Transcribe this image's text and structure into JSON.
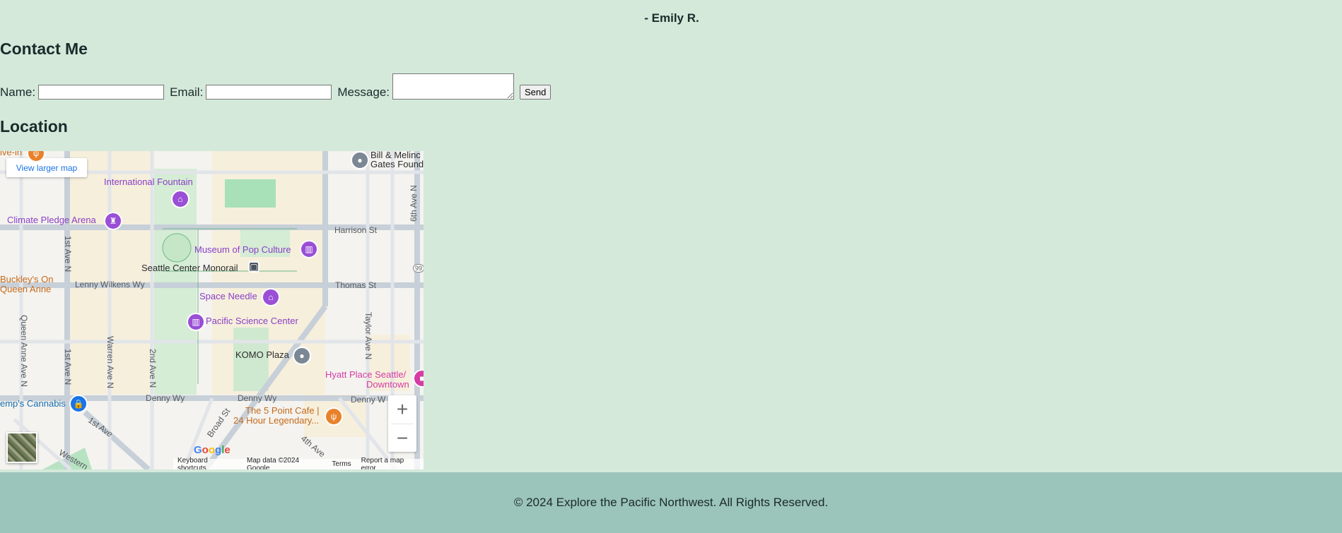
{
  "testimonial": {
    "author": "- Emily R."
  },
  "contact": {
    "heading": "Contact Me",
    "name_label": "Name:",
    "email_label": "Email:",
    "message_label": "Message:",
    "send_label": "Send"
  },
  "location": {
    "heading": "Location",
    "map": {
      "view_larger": "View larger map",
      "labels": {
        "bill_gates_1": "Bill & Melinc",
        "bill_gates_2": "Gates Found",
        "international_fountain": "International Fountain",
        "climate_pledge_arena": "Climate Pledge Arena",
        "harrison_st": "Harrison St",
        "museum_pop_culture": "Museum of Pop Culture",
        "seattle_center_monorail": "Seattle Center Monorail",
        "buckleys_1": "Buckley's On",
        "buckleys_2": "Queen Anne",
        "lenny_wilkens": "Lenny Wilkens Wy",
        "thomas_st": "Thomas St",
        "space_needle": "Space Needle",
        "pacific_science_center": "Pacific Science Center",
        "komo_plaza": "KOMO Plaza",
        "hyatt_1": "Hyatt Place Seattle/",
        "hyatt_2": "Downtown",
        "denny_wy_1": "Denny Wy",
        "denny_wy_2": "Denny Wy",
        "denny_wy_3": "Denny W",
        "kemps": "emp's Cannabis",
        "five_point_1": "The 5 Point Cafe |",
        "five_point_2": "24 Hour Legendary...",
        "first_ave": "1st Ave",
        "broad_st": "Broad St",
        "fourth_ave": "4th Ave",
        "western": "Western",
        "queen_anne_ave_n": "Queen Anne Ave N",
        "first_ave_n_1": "1st Ave N",
        "first_ave_n_2": "1st Ave N",
        "warren_ave_n": "Warren Ave N",
        "second_ave_n": "2nd Ave N",
        "taylor_ave_n": "Taylor Ave N",
        "sixth_ave_n": "6th Ave N",
        "route_99": "99",
        "top_partial": "ive-in"
      },
      "google": [
        "G",
        "o",
        "o",
        "g",
        "l",
        "e"
      ],
      "attribution": {
        "shortcuts": "Keyboard shortcuts",
        "map_data": "Map data ©2024 Google",
        "terms": "Terms",
        "report": "Report a map error"
      },
      "zoom_in": "+",
      "zoom_out": "−"
    }
  },
  "footer": {
    "text": "© 2024 Explore the Pacific Northwest. All Rights Reserved."
  }
}
